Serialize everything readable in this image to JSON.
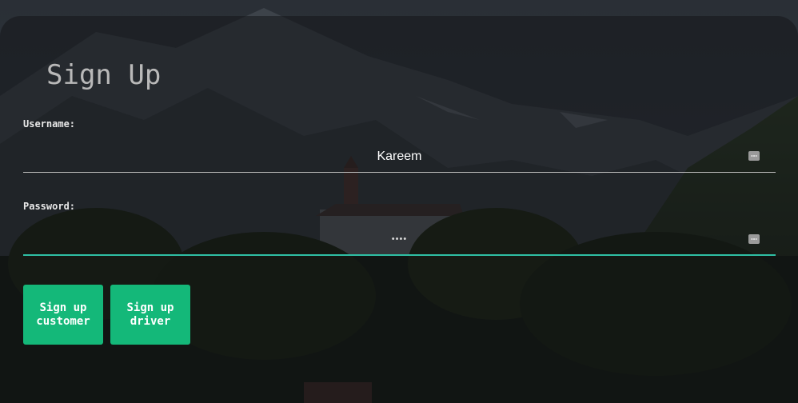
{
  "form": {
    "title": "Sign Up",
    "username": {
      "label": "Username:",
      "value": "Kareem"
    },
    "password": {
      "label": "Password:",
      "value": "Kare"
    },
    "buttons": {
      "customer": "Sign up customer",
      "driver": "Sign up driver"
    }
  },
  "colors": {
    "accent_button": "#14b879",
    "focused_underline": "#2fbfa4",
    "title_text": "#b9b9b9"
  },
  "icons": {
    "field_action_icon": "keyboard-dots-icon"
  }
}
